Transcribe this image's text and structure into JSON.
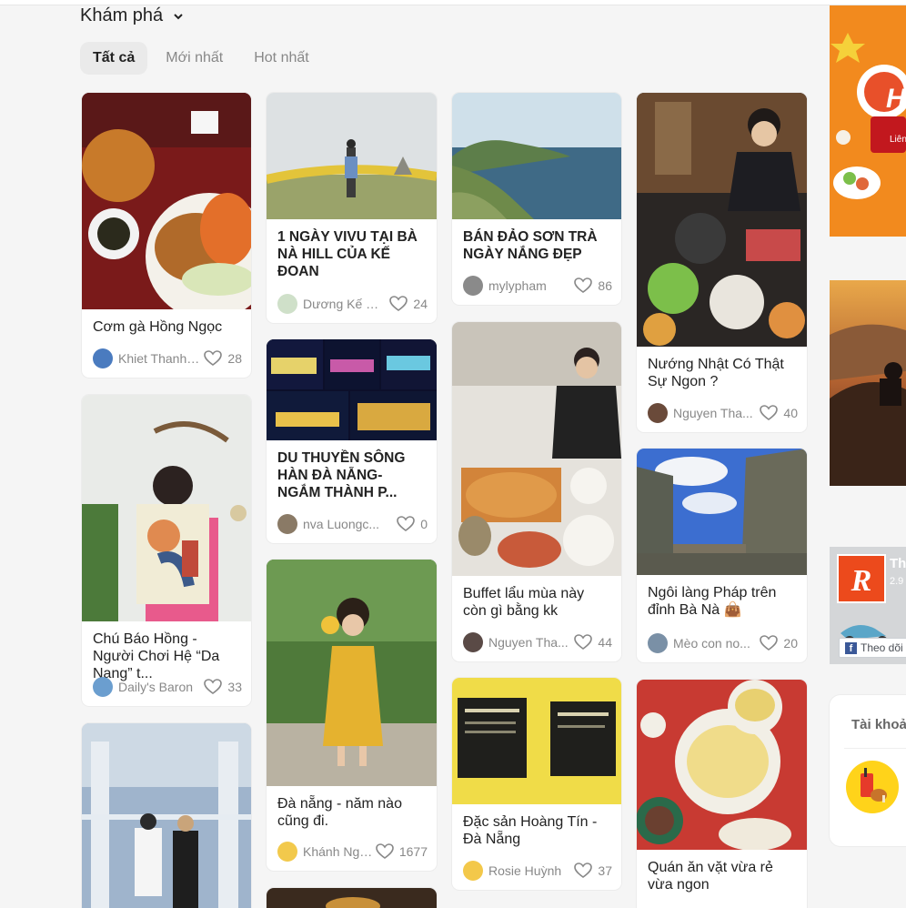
{
  "header": {
    "title": "Khám phá"
  },
  "tabs": [
    {
      "label": "Tất cả"
    },
    {
      "label": "Mới nhất"
    },
    {
      "label": "Hot nhất"
    }
  ],
  "posts": [
    {
      "title": "Cơm gà Hồng Ngọc",
      "author": "Khiet Thanh ...",
      "likes": "28"
    },
    {
      "title": "1 NGÀY VIVU TẠI BÀ NÀ HILL CỦA KẾ ĐOAN",
      "author": "Dương Kế Đ...",
      "likes": "24"
    },
    {
      "title": "BÁN ĐẢO SƠN TRÀ NGÀY NẮNG ĐẸP",
      "author": "mylypham",
      "likes": "86"
    },
    {
      "title": "Nướng Nhật Có Thật Sự Ngon ?",
      "author": "Nguyen Tha...",
      "likes": "40"
    },
    {
      "title": "Chú Báo Hồng - Người Chơi Hệ “Da Nang” t...",
      "author": "Daily's Baron",
      "likes": "33"
    },
    {
      "title": "DU THUYỀN SÔNG HÀN ĐÀ NẴNG- NGẮM THÀNH P...",
      "author": "nva Luongc...",
      "likes": "0"
    },
    {
      "title": "Buffet lẩu mùa này còn gì bằng kk",
      "author": "Nguyen Tha...",
      "likes": "44"
    },
    {
      "title": "Ngôi làng Pháp trên đỉnh Bà Nà 👜",
      "author": "Mèo con no...",
      "likes": "20"
    },
    {
      "title": "Đà nẵng - năm nào cũng đi.",
      "author": "Khánh Nga (...",
      "likes": "1677"
    },
    {
      "title": "Đặc sản Hoàng Tín - Đà Nẵng",
      "author": "Rosie Huỳnh",
      "likes": "37"
    },
    {
      "title": "Quán ăn vặt vừa rẻ vừa ngon",
      "author": "",
      "likes": ""
    }
  ],
  "sidebar": {
    "fb_page_name": "Th",
    "fb_page_count": "2.9",
    "follow_label": "Theo dõi",
    "account_label": "Tài khoả",
    "ad_text_1": "H",
    "ad_text_2": "Liên"
  }
}
